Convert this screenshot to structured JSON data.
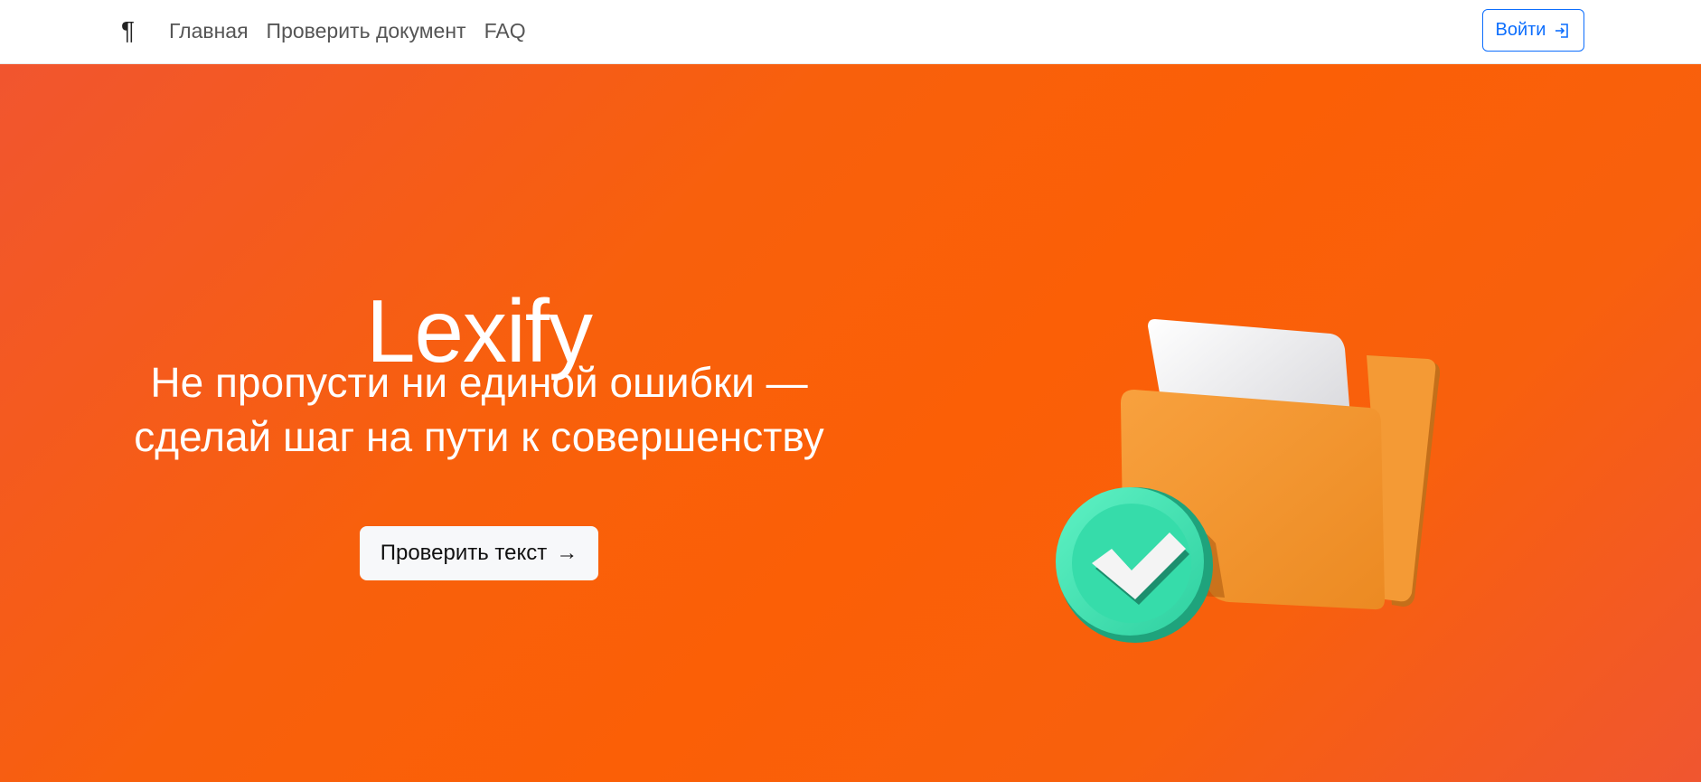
{
  "nav": {
    "brand_symbol": "¶",
    "links": [
      "Главная",
      "Проверить документ",
      "FAQ"
    ],
    "login_label": "Войти"
  },
  "hero": {
    "title": "Lexify",
    "subtitle_line1": "Не пропусти ни единой ошибки —",
    "subtitle_line2": "сделай шаг на пути к совершенству",
    "cta_label": "Проверить текст",
    "cta_arrow": "→"
  },
  "colors": {
    "accent_blue": "#0d6efd",
    "hero_orange": "#fb5f06",
    "check_green": "#3ee6b3",
    "folder_orange": "#f7932b"
  },
  "icons": {
    "login": "box-arrow-in-right-icon",
    "cta_arrow": "arrow-right-icon",
    "illustration": "folder-check-illustration"
  }
}
